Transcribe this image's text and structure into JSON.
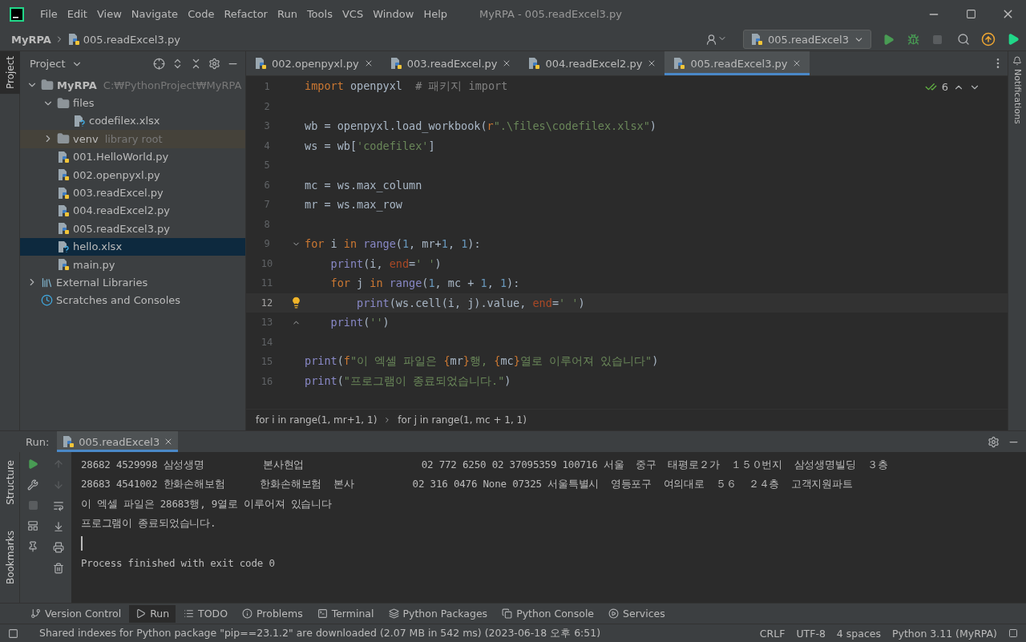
{
  "title_bar": {
    "menu": [
      "File",
      "Edit",
      "View",
      "Navigate",
      "Code",
      "Refactor",
      "Run",
      "Tools",
      "VCS",
      "Window",
      "Help"
    ],
    "title": "MyRPA - 005.readExcel3.py"
  },
  "nav_bar": {
    "breadcrumbs": [
      "MyRPA",
      "005.readExcel3.py"
    ],
    "run_config": "005.readExcel3"
  },
  "left_stripe": {
    "top": [
      {
        "label": "Project",
        "selected": true
      }
    ],
    "bottom": [
      {
        "label": "Structure",
        "selected": false
      },
      {
        "label": "Bookmarks",
        "selected": false
      }
    ]
  },
  "project_panel": {
    "title": "Project",
    "tree": [
      {
        "name": "MyRPA",
        "hint": "C:₩PythonProject₩MyRPA",
        "kind": "folder",
        "expanded": true,
        "selected": false,
        "children": [
          {
            "name": "files",
            "kind": "folder",
            "expanded": true,
            "selected": false,
            "children": [
              {
                "name": "codefilex.xlsx",
                "kind": "unknown",
                "selected": false
              }
            ]
          },
          {
            "name": "venv",
            "hint": "library root",
            "kind": "library_root",
            "expanded": false,
            "selected": false
          },
          {
            "name": "001.HelloWorld.py",
            "kind": "python",
            "selected": false
          },
          {
            "name": "002.openpyxl.py",
            "kind": "python",
            "selected": false
          },
          {
            "name": "003.readExcel.py",
            "kind": "python",
            "selected": false
          },
          {
            "name": "004.readExcel2.py",
            "kind": "python",
            "selected": false
          },
          {
            "name": "005.readExcel3.py",
            "kind": "python",
            "selected": false
          },
          {
            "name": "hello.xlsx",
            "kind": "unknown",
            "selected": true
          },
          {
            "name": "main.py",
            "kind": "python",
            "selected": false
          }
        ]
      },
      {
        "name": "External Libraries",
        "kind": "libraries",
        "expanded": false,
        "selected": false
      },
      {
        "name": "Scratches and Consoles",
        "kind": "scratches",
        "selected": false
      }
    ]
  },
  "editor": {
    "tabs": [
      {
        "label": "002.openpyxl.py",
        "selected": false
      },
      {
        "label": "003.readExcel.py",
        "selected": false
      },
      {
        "label": "004.readExcel2.py",
        "selected": false
      },
      {
        "label": "005.readExcel3.py",
        "selected": true
      }
    ],
    "inspections": "6",
    "lines": [
      {
        "number": "1",
        "current": false,
        "kind": "code",
        "tokens": [
          {
            "kind": "kw",
            "text": "import"
          },
          {
            "kind": "plain",
            "text": " openpyxl  "
          },
          {
            "kind": "comment",
            "text": "# 패키지 import"
          }
        ]
      },
      {
        "number": "2",
        "current": false,
        "kind": "code"
      },
      {
        "number": "3",
        "current": false,
        "kind": "code",
        "tokens": [
          {
            "kind": "plain",
            "text": "wb = openpyxl.load_workbook("
          },
          {
            "kind": "kw",
            "text": "r"
          },
          {
            "kind": "str",
            "text": "\".\\files\\codefilex.xlsx\""
          },
          {
            "kind": "plain",
            "text": ")"
          }
        ]
      },
      {
        "number": "4",
        "current": false,
        "kind": "code",
        "tokens": [
          {
            "kind": "plain",
            "text": "ws = wb["
          },
          {
            "kind": "str",
            "text": "'codefilex'"
          },
          {
            "kind": "plain",
            "text": "]"
          }
        ]
      },
      {
        "number": "5",
        "current": false,
        "kind": "code"
      },
      {
        "number": "6",
        "current": false,
        "kind": "code",
        "tokens": [
          {
            "kind": "plain",
            "text": "mc = ws.max_column"
          }
        ]
      },
      {
        "number": "7",
        "current": false,
        "kind": "code",
        "tokens": [
          {
            "kind": "plain",
            "text": "mr = ws.max_row"
          }
        ]
      },
      {
        "number": "8",
        "current": false,
        "kind": "code"
      },
      {
        "number": "9",
        "current": false,
        "kind": "fold",
        "tokens": [
          {
            "kind": "kw",
            "text": "for"
          },
          {
            "kind": "plain",
            "text": " i "
          },
          {
            "kind": "kw",
            "text": "in "
          },
          {
            "kind": "builtin",
            "text": "range"
          },
          {
            "kind": "plain",
            "text": "("
          },
          {
            "kind": "num",
            "text": "1"
          },
          {
            "kind": "plain",
            "text": ", mr+"
          },
          {
            "kind": "num",
            "text": "1"
          },
          {
            "kind": "plain",
            "text": ", "
          },
          {
            "kind": "num",
            "text": "1"
          },
          {
            "kind": "plain",
            "text": "):"
          }
        ]
      },
      {
        "number": "10",
        "current": false,
        "kind": "code",
        "tokens": [
          {
            "kind": "builtin",
            "text": "    print"
          },
          {
            "kind": "plain",
            "text": "(i, "
          },
          {
            "kind": "param",
            "text": "end"
          },
          {
            "kind": "plain",
            "text": "="
          },
          {
            "kind": "str",
            "text": "' '"
          },
          {
            "kind": "plain",
            "text": ")"
          }
        ]
      },
      {
        "number": "11",
        "current": false,
        "kind": "code",
        "tokens": [
          {
            "kind": "kw",
            "text": "    for"
          },
          {
            "kind": "plain",
            "text": " j "
          },
          {
            "kind": "kw",
            "text": "in "
          },
          {
            "kind": "builtin",
            "text": "range"
          },
          {
            "kind": "plain",
            "text": "("
          },
          {
            "kind": "num",
            "text": "1"
          },
          {
            "kind": "plain",
            "text": ", mc + "
          },
          {
            "kind": "num",
            "text": "1"
          },
          {
            "kind": "plain",
            "text": ", "
          },
          {
            "kind": "num",
            "text": "1"
          },
          {
            "kind": "plain",
            "text": "):"
          }
        ]
      },
      {
        "number": "12",
        "current": true,
        "kind": "bulb",
        "tokens": [
          {
            "kind": "builtin",
            "text": "        print"
          },
          {
            "kind": "plain",
            "text": "(ws.cell(i, j).value, "
          },
          {
            "kind": "param",
            "text": "end"
          },
          {
            "kind": "plain",
            "text": "="
          },
          {
            "kind": "str",
            "text": "' '"
          },
          {
            "kind": "plain",
            "text": ")"
          }
        ]
      },
      {
        "number": "13",
        "current": false,
        "kind": "fold_end",
        "tokens": [
          {
            "kind": "builtin",
            "text": "    print"
          },
          {
            "kind": "plain",
            "text": "("
          },
          {
            "kind": "str",
            "text": "''"
          },
          {
            "kind": "plain",
            "text": ")"
          }
        ]
      },
      {
        "number": "14",
        "current": false,
        "kind": "code"
      },
      {
        "number": "15",
        "current": false,
        "kind": "code",
        "tokens": [
          {
            "kind": "builtin",
            "text": "print"
          },
          {
            "kind": "plain",
            "text": "("
          },
          {
            "kind": "kw",
            "text": "f"
          },
          {
            "kind": "str",
            "text": "\"이 엑셀 파일은 "
          },
          {
            "kind": "kw",
            "text": "{"
          },
          {
            "kind": "plain",
            "text": "mr"
          },
          {
            "kind": "kw",
            "text": "}"
          },
          {
            "kind": "str",
            "text": "행, "
          },
          {
            "kind": "kw",
            "text": "{"
          },
          {
            "kind": "plain",
            "text": "mc"
          },
          {
            "kind": "kw",
            "text": "}"
          },
          {
            "kind": "str",
            "text": "열로 이루어져 있습니다\""
          },
          {
            "kind": "plain",
            "text": ")"
          }
        ]
      },
      {
        "number": "16",
        "current": false,
        "kind": "code",
        "tokens": [
          {
            "kind": "builtin",
            "text": "print"
          },
          {
            "kind": "plain",
            "text": "("
          },
          {
            "kind": "str",
            "text": "\"프로그램이 종료되었습니다.\""
          },
          {
            "kind": "plain",
            "text": ")"
          }
        ]
      }
    ],
    "breadcrumbs": [
      "for i in range(1, mr+1, 1)",
      "for j in range(1, mc + 1, 1)"
    ]
  },
  "right_stripe": {
    "label": "Notifications"
  },
  "run_panel": {
    "title": "Run:",
    "tab": "005.readExcel3",
    "output": [
      {
        "kind": "text",
        "text": "28682 4529998 삼성생명          본사현업                    02 772 6250 02 37095359 100716 서울  중구  태평로２가  １５０번지  삼성생명빌딩  ３층"
      },
      {
        "kind": "text",
        "text": "28683 4541002 한화손해보험      한화손해보험  본사          02 316 0476 None 07325 서울특별시  영등포구  여의대로  ５６  ２４층  고객지원파트"
      },
      {
        "kind": "text",
        "text": "이 엑셀 파일은 28683행, 9열로 이루어져 있습니다"
      },
      {
        "kind": "text",
        "text": "프로그램이 종료되었습니다."
      },
      {
        "kind": "caret"
      },
      {
        "kind": "text",
        "text": "Process finished with exit code 0"
      }
    ]
  },
  "tool_bar": [
    {
      "label": "Version Control",
      "kind": "vcs",
      "selected": false
    },
    {
      "label": "Run",
      "kind": "run",
      "selected": true
    },
    {
      "label": "TODO",
      "kind": "todo",
      "selected": false
    },
    {
      "label": "Problems",
      "kind": "problems",
      "selected": false
    },
    {
      "label": "Terminal",
      "kind": "terminal",
      "selected": false
    },
    {
      "label": "Python Packages",
      "kind": "packages",
      "selected": false
    },
    {
      "label": "Python Console",
      "kind": "console",
      "selected": false
    },
    {
      "label": "Services",
      "kind": "services",
      "selected": false
    }
  ],
  "status_bar": {
    "message": "Shared indexes for Python package \"pip==23.1.2\" are downloaded (2.07 MB in 542 ms) (2023-06-18 오후 6:51)",
    "items": [
      "CRLF",
      "UTF-8",
      "4 spaces",
      "Python 3.11 (MyRPA)"
    ]
  }
}
